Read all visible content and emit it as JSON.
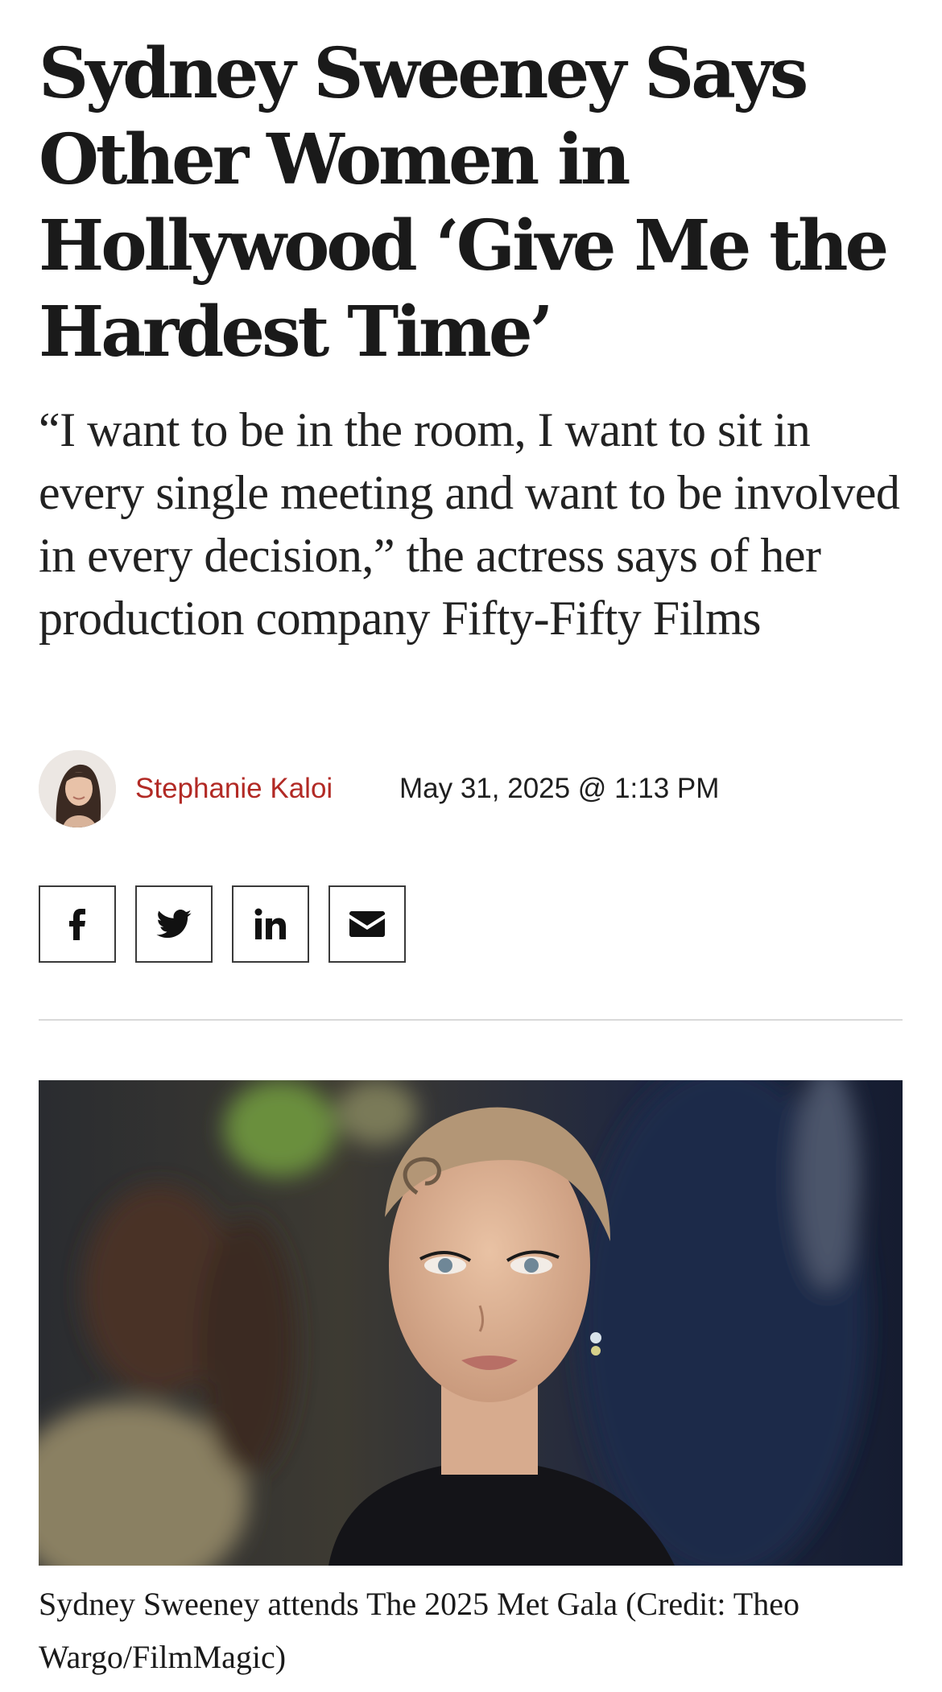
{
  "article": {
    "headline": "Sydney Sweeney Says Other Women in Hollywood ‘Give Me the Hardest Time’",
    "dek": "“I want to be in the room, I want to sit in every single meeting and want to be involved in every decision,” the actress says of her production company Fifty-Fifty Films",
    "author": "Stephanie Kaloi",
    "date": "May 31, 2025 @ 1:13 PM",
    "caption": "Sydney Sweeney attends The 2025 Met Gala (Credit: Theo Wargo/FilmMagic)"
  },
  "share": [
    {
      "name": "facebook",
      "icon": "facebook-icon"
    },
    {
      "name": "twitter",
      "icon": "twitter-icon"
    },
    {
      "name": "linkedin",
      "icon": "linkedin-icon"
    },
    {
      "name": "email",
      "icon": "email-icon"
    }
  ],
  "colors": {
    "author_link": "#b22a25",
    "text": "#1a1a1a",
    "divider": "#d9d9d9",
    "button_border": "#3a3a3a"
  }
}
